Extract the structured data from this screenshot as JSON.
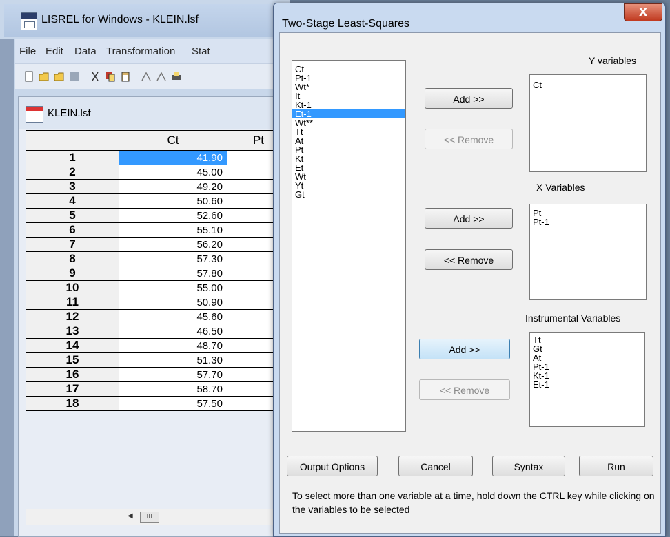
{
  "app": {
    "title": "LISREL for Windows - KLEIN.lsf",
    "menu": [
      "File",
      "Edit",
      "Data",
      "Transformation",
      "Stat"
    ]
  },
  "document": {
    "title": "KLEIN.lsf",
    "columns": [
      "Ct",
      "Pt"
    ],
    "rows": [
      {
        "n": "1",
        "ct": "41.90"
      },
      {
        "n": "2",
        "ct": "45.00"
      },
      {
        "n": "3",
        "ct": "49.20"
      },
      {
        "n": "4",
        "ct": "50.60"
      },
      {
        "n": "5",
        "ct": "52.60"
      },
      {
        "n": "6",
        "ct": "55.10"
      },
      {
        "n": "7",
        "ct": "56.20"
      },
      {
        "n": "8",
        "ct": "57.30"
      },
      {
        "n": "9",
        "ct": "57.80"
      },
      {
        "n": "10",
        "ct": "55.00"
      },
      {
        "n": "11",
        "ct": "50.90"
      },
      {
        "n": "12",
        "ct": "45.60"
      },
      {
        "n": "13",
        "ct": "46.50"
      },
      {
        "n": "14",
        "ct": "48.70"
      },
      {
        "n": "15",
        "ct": "51.30"
      },
      {
        "n": "16",
        "ct": "57.70"
      },
      {
        "n": "17",
        "ct": "58.70"
      },
      {
        "n": "18",
        "ct": "57.50"
      }
    ],
    "scroll_thumb": "III"
  },
  "dialog": {
    "title": "Two-Stage Least-Squares",
    "close": "X",
    "source_list": [
      "Ct",
      "Pt-1",
      "Wt*",
      "It",
      "Kt-1",
      "Et-1",
      "Wt**",
      "Tt",
      "At",
      "Pt",
      "Kt",
      "Et",
      "Wt",
      "Yt",
      "Gt"
    ],
    "source_selected": "Et-1",
    "y_label": "Y variables",
    "y_list": [
      "Ct"
    ],
    "x_label": "X Variables",
    "x_list": [
      "Pt",
      "Pt-1"
    ],
    "inst_label": "Instrumental Variables",
    "inst_list": [
      "Tt",
      "Gt",
      "At",
      "Pt-1",
      "Kt-1",
      "Et-1"
    ],
    "add_label": "Add >>",
    "remove_label": "<< Remove",
    "buttons": {
      "output": "Output Options",
      "cancel": "Cancel",
      "syntax": "Syntax",
      "run": "Run"
    },
    "hint": "To select more than one variable at a time, hold down the CTRL key while clicking on the variables to be selected"
  },
  "colors": {
    "selection": "#3399ff",
    "close_button": "#c0391f"
  }
}
